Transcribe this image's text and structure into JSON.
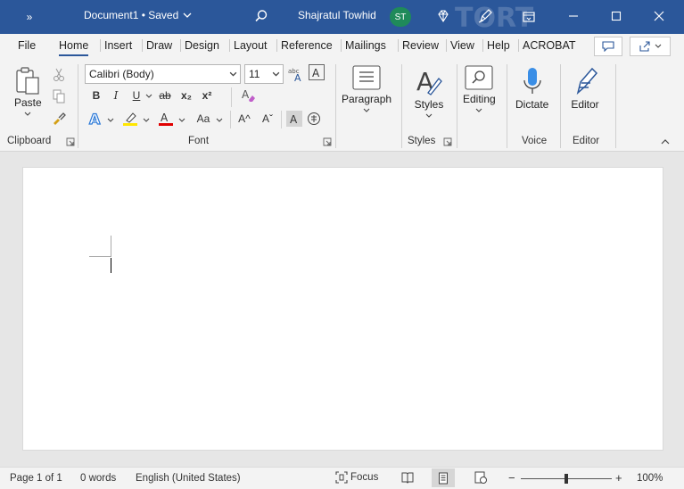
{
  "titlebar": {
    "more_label": "»",
    "document_title": "Document1 • Saved",
    "user_name": "Shajratul Towhid",
    "user_initials": "ST"
  },
  "tabs": [
    "File",
    "Home",
    "Insert",
    "Draw",
    "Design",
    "Layout",
    "Reference",
    "Mailings",
    "Review",
    "View",
    "Help",
    "ACROBAT"
  ],
  "active_tab": "Home",
  "ribbon": {
    "clipboard": {
      "paste_label": "Paste",
      "group_label": "Clipboard"
    },
    "font": {
      "font_name": "Calibri (Body)",
      "font_size": "11",
      "bold": "B",
      "italic": "I",
      "underline": "U",
      "strike": "ab",
      "subscript": "x₂",
      "superscript": "x²",
      "change_case": "Aa",
      "grow": "A^",
      "shrink": "Aˇ",
      "group_label": "Font"
    },
    "paragraph": {
      "label": "Paragraph"
    },
    "styles": {
      "label": "Styles",
      "group_label": "Styles"
    },
    "editing": {
      "label": "Editing"
    },
    "voice": {
      "dictate_label": "Dictate",
      "group_label": "Voice"
    },
    "editor": {
      "label": "Editor",
      "group_label": "Editor"
    }
  },
  "statusbar": {
    "page": "Page 1 of 1",
    "words": "0 words",
    "language": "English (United States)",
    "focus": "Focus",
    "zoom_minus": "−",
    "zoom_plus": "+",
    "zoom_level": "100%",
    "zoom_fraction": 0.5
  },
  "colors": {
    "titlebar": "#2b579a",
    "highlight": "#ffe600",
    "font_color": "#e00000",
    "avatar": "#1f8a5a"
  }
}
